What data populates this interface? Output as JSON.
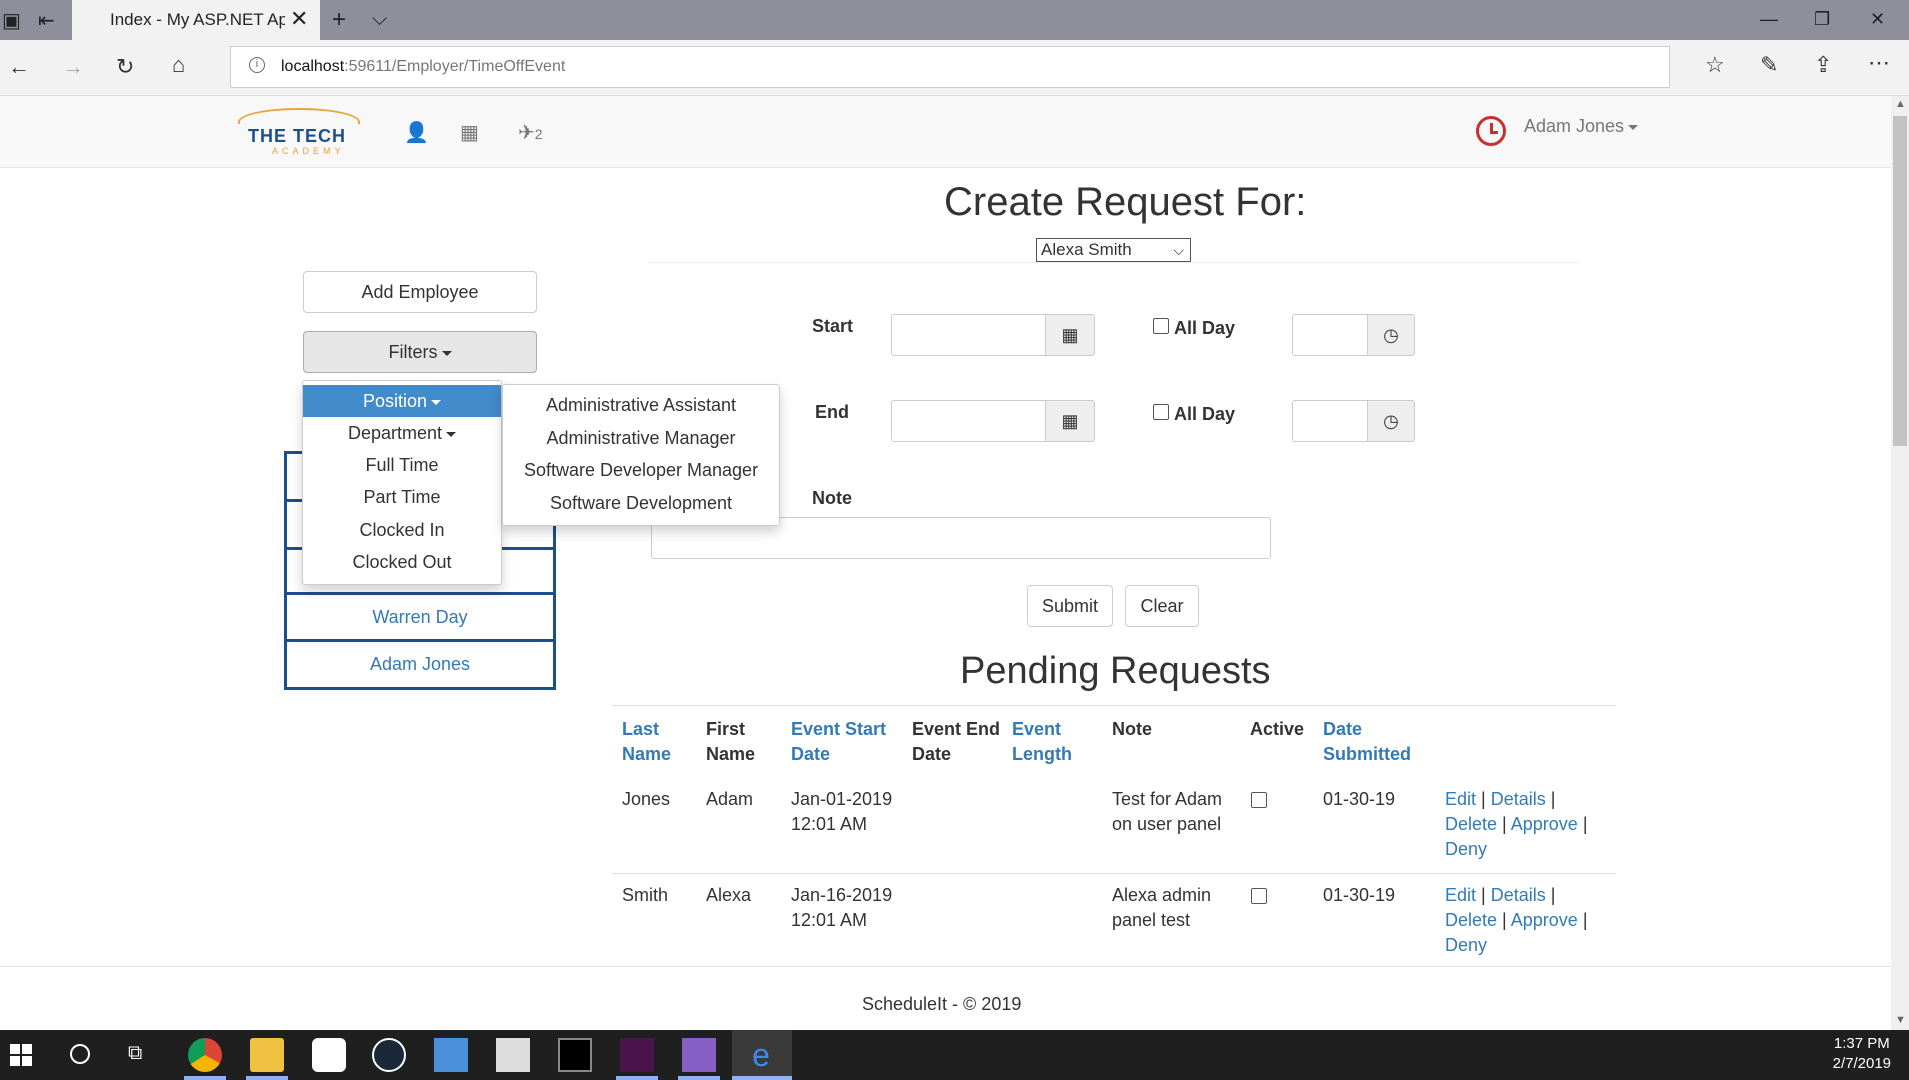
{
  "browser": {
    "tab_title": "Index - My ASP.NET Ap",
    "url_host": "localhost",
    "url_rest": ":59611/Employer/TimeOffEvent"
  },
  "navbar": {
    "brand": "THE TECH",
    "brand_sub": "ACADEMY",
    "user_name": "Adam Jones",
    "nav_badge": "2"
  },
  "sidebar": {
    "add_employee": "Add Employee",
    "filters": "Filters",
    "employees": [
      "Warren Day",
      "Adam Jones"
    ]
  },
  "filter_menu": {
    "items": [
      "Position",
      "Department",
      "Full Time",
      "Part Time",
      "Clocked In",
      "Clocked Out"
    ],
    "active": "Position"
  },
  "position_menu": {
    "items": [
      "Administrative Assistant",
      "Administrative Manager",
      "Software Developer Manager",
      "Software Development"
    ]
  },
  "request_form": {
    "title": "Create Request For:",
    "selected_employee": "Alexa Smith",
    "start_label": "Start",
    "end_label": "End",
    "all_day_label": "All Day",
    "note_label": "Note",
    "submit": "Submit",
    "clear": "Clear"
  },
  "pending": {
    "title": "Pending Requests",
    "headers": {
      "last_name": "Last Name",
      "first_name": "First Name",
      "event_start": "Event Start Date",
      "event_end": "Event End Date",
      "event_length": "Event Length",
      "note": "Note",
      "active": "Active",
      "date_submitted": "Date Submitted"
    },
    "rows": [
      {
        "last": "Jones",
        "first": "Adam",
        "start_date": "Jan-01-2019",
        "start_time": "12:01 AM",
        "note1": "Test for Adam",
        "note2": "on user panel",
        "submitted": "01-30-19"
      },
      {
        "last": "Smith",
        "first": "Alexa",
        "start_date": "Jan-16-2019",
        "start_time": "12:01 AM",
        "note1": "Alexa admin",
        "note2": "panel test",
        "submitted": "01-30-19"
      }
    ],
    "actions": {
      "edit": "Edit",
      "details": "Details",
      "delete": "Delete",
      "approve": "Approve",
      "deny": "Deny",
      "sep": "|"
    }
  },
  "footer": {
    "text": "ScheduleIt - © 2019"
  },
  "taskbar": {
    "time": "1:37 PM",
    "date": "2/7/2019"
  },
  "colors": {
    "link": "#337ab7",
    "active_menu": "#428bca",
    "brand_blue": "#1d4f8c",
    "brand_orange": "#e8a43a",
    "alert_red": "#c9302c"
  },
  "icons": [
    "user-icon",
    "calendar-icon",
    "plane-icon",
    "clock-alert-icon",
    "calendar-picker-icon",
    "time-picker-icon"
  ]
}
